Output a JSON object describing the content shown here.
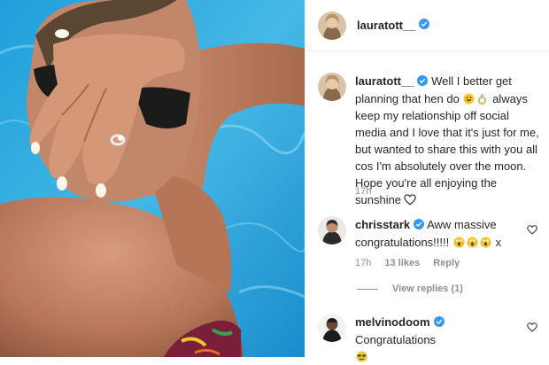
{
  "post": {
    "username": "lauratott__",
    "verified": true,
    "photo_alt": "woman covering face with hand showing engagement ring by the pool"
  },
  "caption": {
    "username": "lauratott__",
    "text_part1": "Well I better get planning that hen do",
    "text_part2": "always keep my relationship off social media and I love that it's just for me, but wanted to share this with you all cos I'm absolutely over the moon. Hope you're all enjoying the sunshine",
    "time": "17h"
  },
  "comments": [
    {
      "username": "chrisstark",
      "text": "Aww massive congratulations!!!!!",
      "suffix": "x",
      "time": "17h",
      "likes": "13 likes",
      "reply_label": "Reply",
      "view_replies": "View replies (1)"
    },
    {
      "username": "melvinodoom",
      "text": "Congratulations"
    }
  ],
  "colors": {
    "verified": "#3897f0",
    "meta": "#8e8e8e",
    "pool": "#2fa7dd"
  },
  "icons": {
    "verified": "verified-badge-icon",
    "heart": "heart-outline-icon",
    "emoji_grin": "grinning-face-emoji",
    "emoji_ring": "ring-emoji",
    "emoji_scream": "screaming-face-emoji",
    "emoji_sunglasses": "sunglasses-face-emoji"
  }
}
